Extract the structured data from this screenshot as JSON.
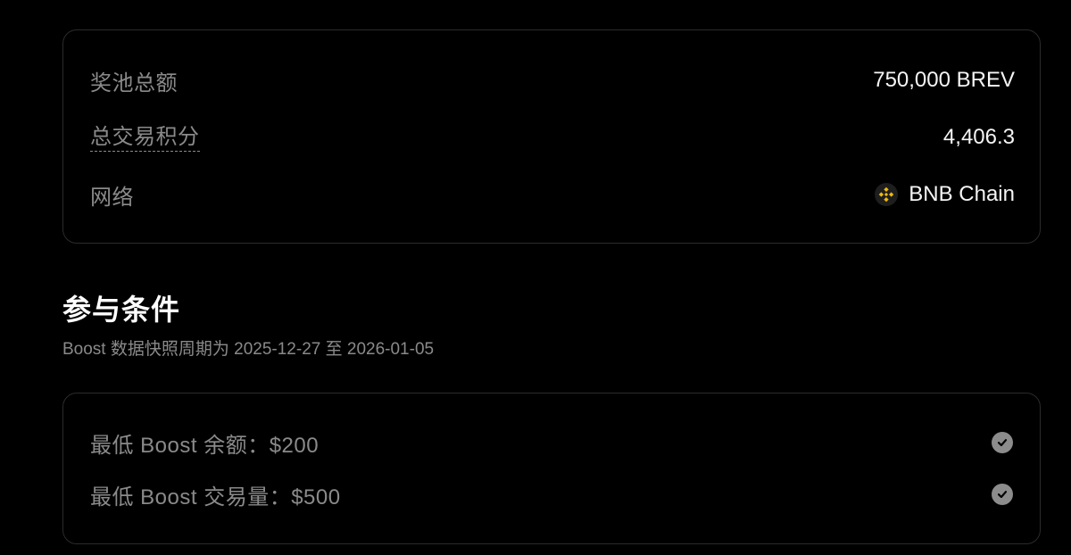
{
  "pool": {
    "rows": [
      {
        "label": "奖池总额",
        "value": "750,000 BREV"
      },
      {
        "label": "总交易积分",
        "value": "4,406.3"
      },
      {
        "label": "网络",
        "value": "BNB Chain",
        "icon": "bnb-chain-icon"
      }
    ]
  },
  "conditions": {
    "title": "参与条件",
    "subtitle": "Boost 数据快照周期为 2025-12-27 至 2026-01-05",
    "items": [
      {
        "label": "最低 Boost 余额：$200",
        "icon": "check-circle-icon"
      },
      {
        "label": "最低 Boost 交易量：$500",
        "icon": "check-circle-icon"
      }
    ]
  },
  "colors": {
    "background": "#000000",
    "border": "#2b2b2b",
    "muted_text": "#8a8a8a",
    "bnb_yellow": "#F0B90B"
  }
}
